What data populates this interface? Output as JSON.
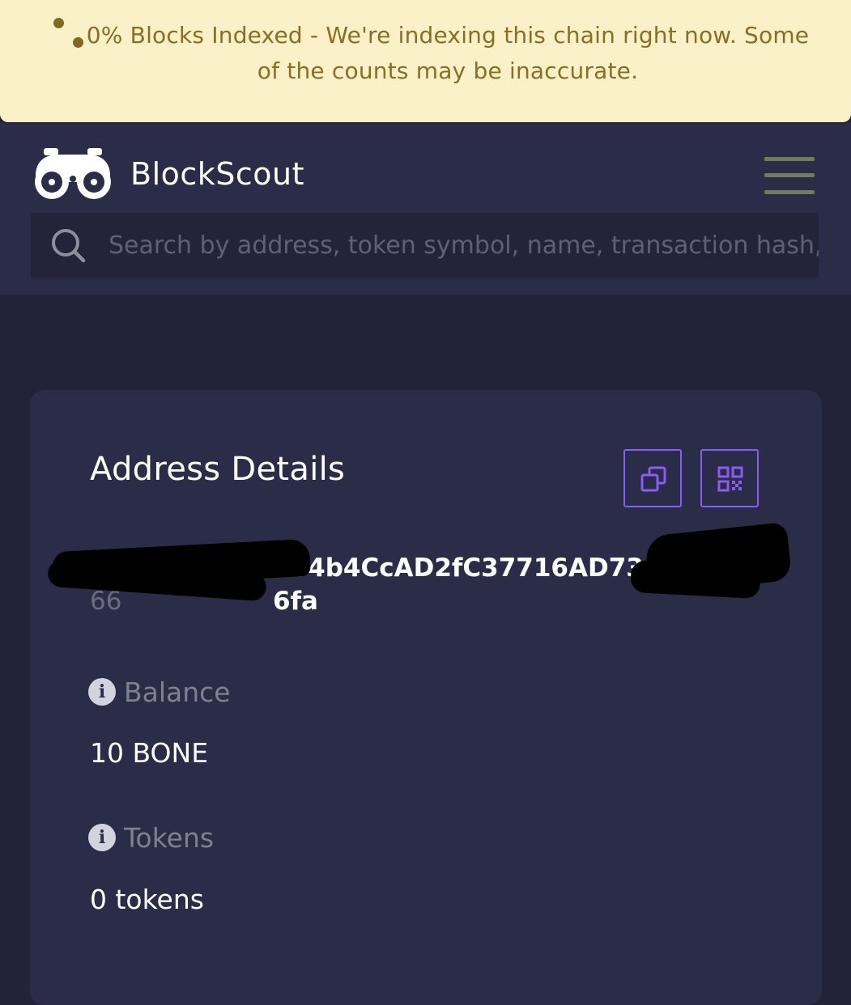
{
  "banner": {
    "message": "0% Blocks Indexed - We're indexing this chain right now. Some of the counts may be inaccurate."
  },
  "header": {
    "brand": "BlockScout",
    "logo_icon": "binoculars-icon",
    "menu_icon": "hamburger-menu-icon"
  },
  "search": {
    "placeholder": "Search by address, token symbol, name, transaction hash, or block number",
    "icon": "search-icon"
  },
  "card": {
    "title": "Address Details",
    "copy_icon": "copy-icon",
    "qr_icon": "qr-code-icon",
    "address_visible": "764b4CcAD2fC37716AD736fa",
    "address_tail": "66",
    "fields": [
      {
        "label": "Balance",
        "value": "10 BONE"
      },
      {
        "label": "Tokens",
        "value": "0 tokens"
      }
    ]
  },
  "colors": {
    "banner_bg": "#fbf1c9",
    "banner_text": "#8a6e22",
    "header_bg": "#2b2c48",
    "page_bg": "#22233a",
    "accent": "#8a5cf5",
    "menu": "#6f7d5a"
  }
}
